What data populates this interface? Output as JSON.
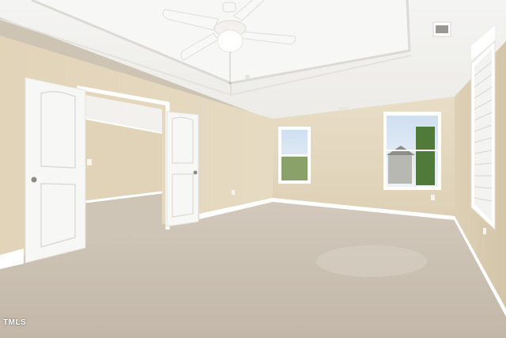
{
  "photo": {
    "subject": "empty-bedroom",
    "watermark": "TMLS",
    "colors": {
      "wall": "#e3d6bd",
      "wall_shadow": "#d6c8ad",
      "ceiling": "#f1f0ec",
      "carpet": "#c9bfb1",
      "trim": "#ffffff",
      "door": "#f7f7f5"
    },
    "icons": [
      "ceiling-fan-icon",
      "air-vent-icon",
      "window-icon",
      "door-icon"
    ]
  }
}
